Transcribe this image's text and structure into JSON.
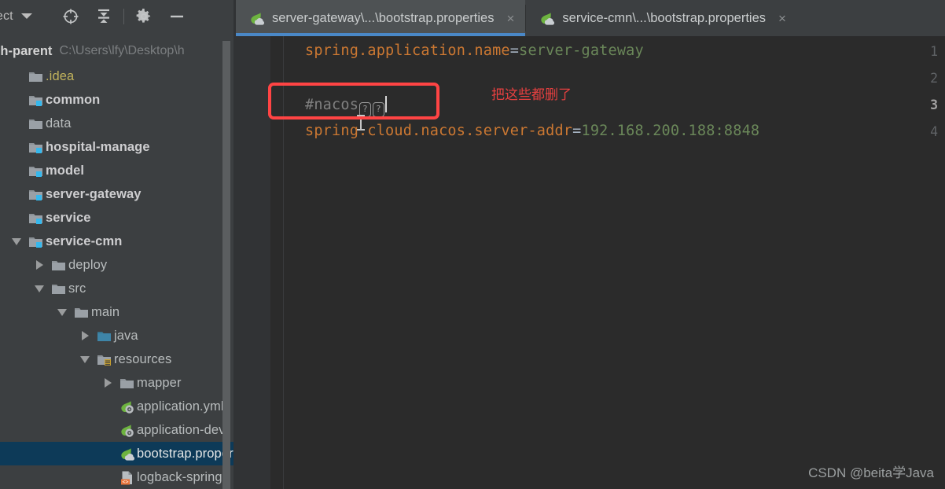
{
  "sidebar": {
    "title": "oject",
    "caret_icon": "chevron-down-icon",
    "toolbar": [
      {
        "name": "locate-icon",
        "label": "Select Opened File"
      },
      {
        "name": "collapse-all-icon",
        "label": "Collapse All"
      },
      {
        "name": "gear-icon",
        "label": "Settings"
      },
      {
        "name": "minimize-icon",
        "label": "Hide"
      }
    ],
    "project": {
      "name": "yygh-parent",
      "path": "C:\\Users\\lfy\\Desktop\\h"
    },
    "tree": [
      {
        "label": ".idea",
        "indent": 0,
        "twisty": "none",
        "icon": "folder-icon",
        "style": "yellow",
        "selected": false
      },
      {
        "label": "common",
        "indent": 0,
        "twisty": "none",
        "icon": "module-folder-icon",
        "style": "bold",
        "selected": false
      },
      {
        "label": "data",
        "indent": 0,
        "twisty": "none",
        "icon": "folder-icon",
        "style": "plain",
        "selected": false
      },
      {
        "label": "hospital-manage",
        "indent": 0,
        "twisty": "none",
        "icon": "module-folder-icon",
        "style": "bold",
        "selected": false
      },
      {
        "label": "model",
        "indent": 0,
        "twisty": "none",
        "icon": "module-folder-icon",
        "style": "bold",
        "selected": false
      },
      {
        "label": "server-gateway",
        "indent": 0,
        "twisty": "none",
        "icon": "module-folder-icon",
        "style": "bold",
        "selected": false
      },
      {
        "label": "service",
        "indent": 0,
        "twisty": "none",
        "icon": "module-folder-icon",
        "style": "bold",
        "selected": false
      },
      {
        "label": "service-cmn",
        "indent": 0,
        "twisty": "down",
        "icon": "module-folder-icon",
        "style": "bold",
        "selected": false
      },
      {
        "label": "deploy",
        "indent": 1,
        "twisty": "right",
        "icon": "folder-icon",
        "style": "plain",
        "selected": false
      },
      {
        "label": "src",
        "indent": 1,
        "twisty": "down",
        "icon": "folder-icon",
        "style": "plain",
        "selected": false
      },
      {
        "label": "main",
        "indent": 2,
        "twisty": "down",
        "icon": "folder-icon",
        "style": "plain",
        "selected": false
      },
      {
        "label": "java",
        "indent": 3,
        "twisty": "right",
        "icon": "sources-folder-icon",
        "style": "plain",
        "selected": false
      },
      {
        "label": "resources",
        "indent": 3,
        "twisty": "down",
        "icon": "resources-folder-icon",
        "style": "plain",
        "selected": false
      },
      {
        "label": "mapper",
        "indent": 4,
        "twisty": "right",
        "icon": "folder-icon",
        "style": "plain",
        "selected": false
      },
      {
        "label": "application.yml",
        "indent": 4,
        "twisty": "none",
        "icon": "spring-yaml-icon",
        "style": "plain",
        "selected": false
      },
      {
        "label": "application-dev",
        "indent": 4,
        "twisty": "none",
        "icon": "spring-yaml-icon",
        "style": "plain",
        "selected": false
      },
      {
        "label": "bootstrap.properties",
        "indent": 4,
        "twisty": "none",
        "icon": "spring-cloud-icon",
        "style": "white",
        "selected": true
      },
      {
        "label": "logback-spring.",
        "indent": 4,
        "twisty": "none",
        "icon": "xml-file-icon",
        "style": "plain",
        "selected": false
      }
    ]
  },
  "editor": {
    "tabs": [
      {
        "label": "server-gateway\\...\\bootstrap.properties",
        "icon": "spring-cloud-icon",
        "close": "×",
        "active": true
      },
      {
        "label": "service-cmn\\...\\bootstrap.properties",
        "icon": "spring-cloud-icon",
        "close": "×",
        "active": false
      }
    ],
    "line_numbers": [
      "1",
      "2",
      "3",
      "4"
    ],
    "current_line": 3,
    "lines": [
      {
        "n": 1,
        "key": "spring.application.name",
        "eq": "=",
        "value": "server-gateway",
        "comment": ""
      },
      {
        "n": 2,
        "key": "",
        "eq": "",
        "value": "",
        "comment": ""
      },
      {
        "n": 3,
        "key": "",
        "eq": "",
        "value": "",
        "comment": "#nacos"
      },
      {
        "n": 4,
        "key": "spring.cloud.nacos.server-addr",
        "eq": "=",
        "value": "192.168.200.188:8848",
        "comment": ""
      }
    ],
    "unknown_glyph_1": "?",
    "unknown_glyph_2": "?"
  },
  "annotation": {
    "text": "把这些都删了",
    "color": "#ff4444"
  },
  "watermark": "CSDN @beita学Java",
  "colors": {
    "accent_tab_underline": "#4a88c7",
    "selection": "#0d3a58",
    "key": "#cc7832",
    "value": "#6a8759",
    "comment": "#808080",
    "annotation_red": "#ff4444"
  }
}
